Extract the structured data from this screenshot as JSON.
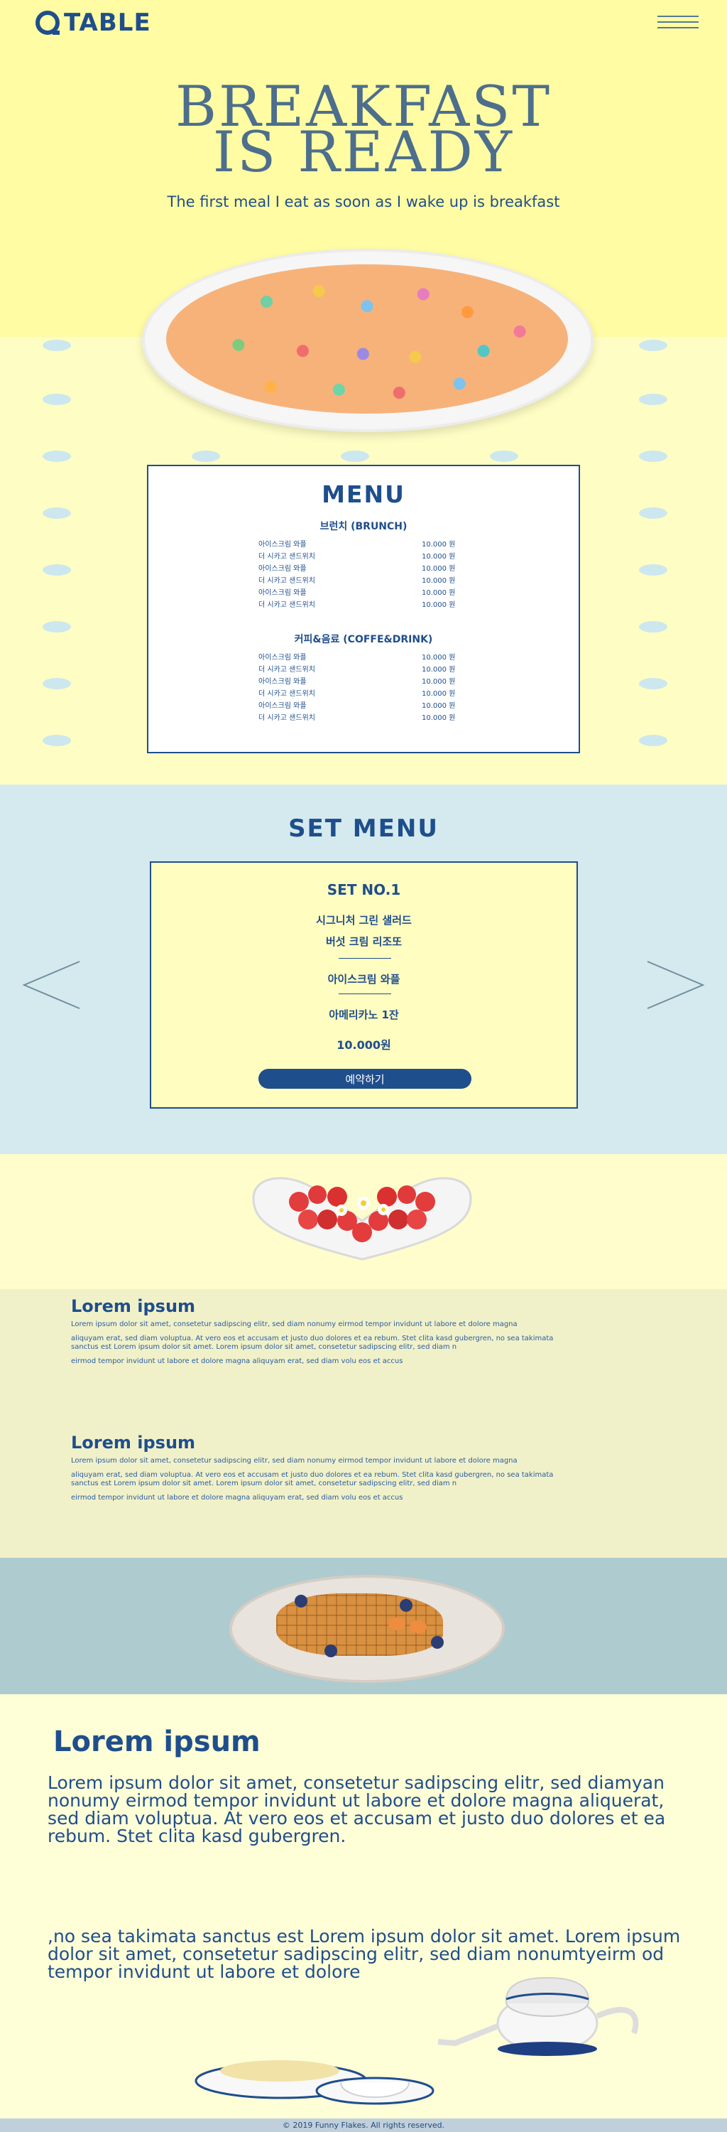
{
  "header": {
    "logo_text": "TABLE",
    "menu_icon": "hamburger-icon"
  },
  "hero": {
    "title_line1": "BREAKFAST",
    "title_line2": "IS READY",
    "subtitle": "The first meal I eat as soon as I wake up is breakfast"
  },
  "menu": {
    "title": "MENU",
    "section1": "브런치 (BRUNCH)",
    "section2": "커피&음료 (COFFE&DRINK)",
    "items1": [
      {
        "name": "아이스크림 와플",
        "price": "10.000 원"
      },
      {
        "name": "더 시카고 샌드위치",
        "price": "10.000 원"
      },
      {
        "name": "아이스크림 와플",
        "price": "10.000 원"
      },
      {
        "name": "더 시카고 샌드위치",
        "price": "10.000 원"
      },
      {
        "name": "아이스크림 와플",
        "price": "10.000 원"
      },
      {
        "name": "더 시카고 샌드위치",
        "price": "10.000 원"
      }
    ],
    "items2": [
      {
        "name": "아이스크림 와플",
        "price": "10.000 원"
      },
      {
        "name": "더 시카고 샌드위치",
        "price": "10.000 원"
      },
      {
        "name": "아이스크림 와플",
        "price": "10.000 원"
      },
      {
        "name": "더 시카고 샌드위치",
        "price": "10.000 원"
      },
      {
        "name": "아이스크림 와플",
        "price": "10.000 원"
      },
      {
        "name": "더 시카고 샌드위치",
        "price": "10.000 원"
      }
    ]
  },
  "set_menu": {
    "title": "SET MENU",
    "card_title": "SET NO.1",
    "line1": "시그니처 그린 샐러드",
    "line2": "버섯 크림 리조또",
    "line3": "아이스크림 와플",
    "line4": "아메리카노 1잔",
    "price": "10.000원",
    "button_label": "예약하기"
  },
  "text_blocks": [
    {
      "title": "Lorem ipsum",
      "p1": "Lorem ipsum dolor sit amet, consetetur sadipscing elitr, sed diam nonumy eirmod tempor invidunt ut labore et dolore magna",
      "p2": "aliquyam erat, sed diam voluptua. At vero eos et accusam et justo duo dolores et ea rebum. Stet clita kasd gubergren, no sea takimata sanctus est Lorem ipsum dolor sit amet. Lorem ipsum dolor sit amet, consetetur sadipscing elitr, sed diam n",
      "p3": " eirmod tempor invidunt ut labore et dolore magna aliquyam erat, sed diam volu eos et accus"
    },
    {
      "title": "Lorem ipsum",
      "p1": "Lorem ipsum dolor sit amet, consetetur sadipscing elitr, sed diam nonumy eirmod tempor invidunt ut labore et dolore magna",
      "p2": "aliquyam erat, sed diam voluptua. At vero eos et accusam et justo duo dolores et ea rebum. Stet clita kasd gubergren, no sea takimata sanctus est Lorem ipsum dolor sit amet. Lorem ipsum dolor sit amet, consetetur sadipscing elitr, sed diam n",
      "p3": " eirmod tempor invidunt ut labore et dolore magna aliquyam erat, sed diam volu eos et accus"
    }
  ],
  "bottom": {
    "title": "Lorem ipsum",
    "paragraph1": "Lorem ipsum dolor sit amet, consetetur sadipscing elitr, sed diamyan nonumy eirmod tempor invidunt ut labore et dolore magna aliquerat, sed diam voluptua.  At vero eos et accusam et justo duo dolores et ea rebum. Stet clita kasd gubergren.",
    "paragraph2": ",no sea takimata sanctus est Lorem ipsum  dolor sit amet. Lorem ipsum dolor sit amet, consetetur sadipscing elitr,  sed diam nonumtyeirm od tempor invidunt ut labore et dolore"
  },
  "footer": {
    "text": "© 2019 Funny Flakes. All rights reserved."
  }
}
